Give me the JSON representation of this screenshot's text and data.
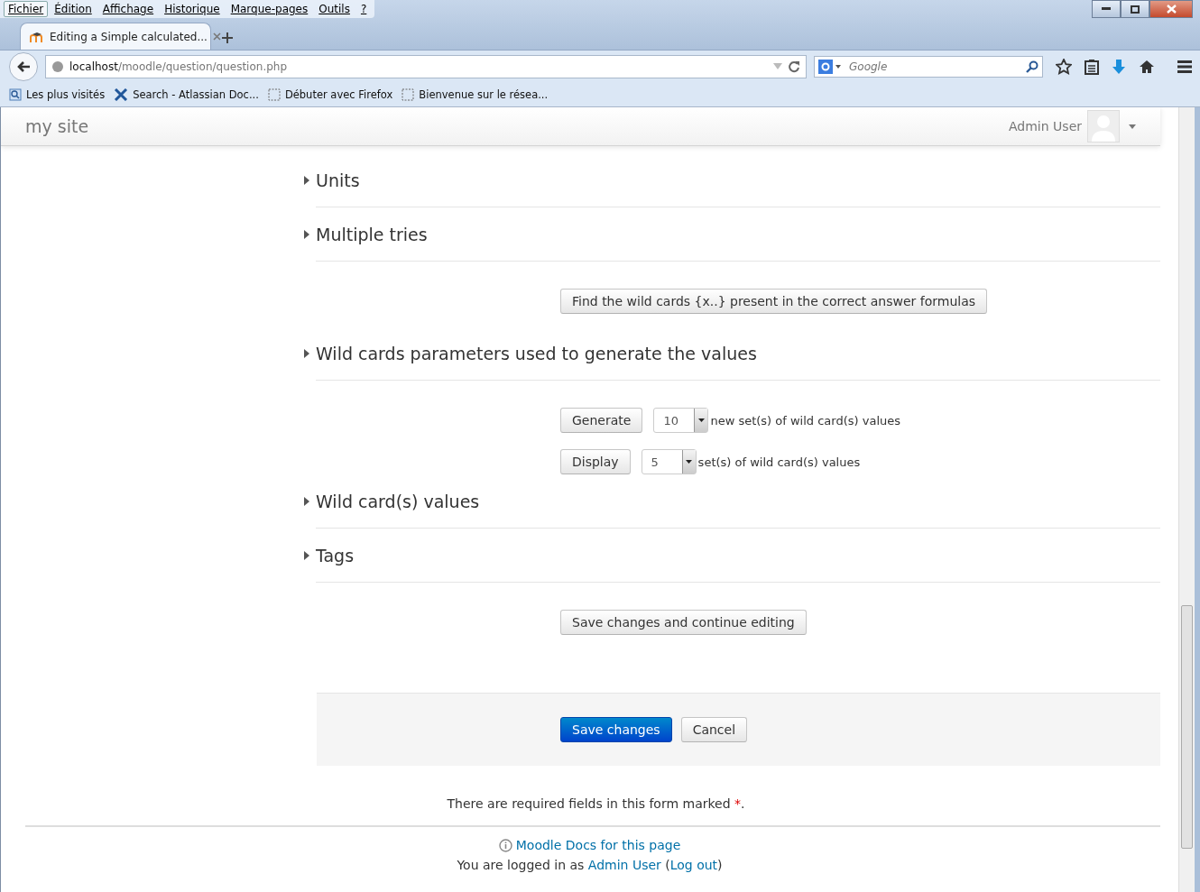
{
  "menu_bar": [
    {
      "label": "Fichier",
      "selected": true
    },
    {
      "label": "Édition",
      "selected": false
    },
    {
      "label": "Affichage",
      "selected": false
    },
    {
      "label": "Historique",
      "selected": false
    },
    {
      "label": "Marque-pages",
      "selected": false
    },
    {
      "label": "Outils",
      "selected": false
    },
    {
      "label": "?",
      "selected": false
    }
  ],
  "tabs": [
    {
      "title": "Editing a Simple calculated...",
      "selected": true
    }
  ],
  "address_bar": {
    "host": "localhost",
    "path": "/moodle/question/question.php"
  },
  "search": {
    "placeholder": "Google"
  },
  "bookmarks": [
    {
      "label": "Les plus visités",
      "kind": "folder"
    },
    {
      "label": "Search - Atlassian Doc...",
      "kind": "site"
    },
    {
      "label": "Débuter avec Firefox",
      "kind": "blank"
    },
    {
      "label": "Bienvenue sur le résea...",
      "kind": "blank"
    }
  ],
  "navbar": {
    "brand": "my site",
    "user": "Admin User"
  },
  "form_items": [
    {
      "kind": "section",
      "title": "Units",
      "expanded": false
    },
    {
      "kind": "section",
      "title": "Multiple tries",
      "expanded": false
    },
    {
      "kind": "button",
      "label": "Find the wild cards {x..} present in the correct answer formulas"
    },
    {
      "kind": "section",
      "title": "Wild cards parameters used to generate the values",
      "expanded": false
    },
    {
      "kind": "select_row",
      "button": "Generate",
      "value": "10",
      "text": "new set(s) of wild card(s) values"
    },
    {
      "kind": "select_row",
      "button": "Display",
      "value": "5",
      "text": "set(s) of wild card(s) values"
    },
    {
      "kind": "section",
      "title": "Wild card(s) values",
      "expanded": false
    },
    {
      "kind": "section",
      "title": "Tags",
      "expanded": false
    },
    {
      "kind": "button",
      "label": "Save changes and continue editing"
    }
  ],
  "actions": [
    {
      "label": "Save changes",
      "primary": true
    },
    {
      "label": "Cancel",
      "primary": false
    }
  ],
  "required_note": {
    "text": "There are required fields in this form marked",
    "mark": "*",
    "end": "."
  },
  "footer": {
    "docs_link": "Moodle Docs for this page",
    "login": {
      "prefix": "You are logged in as",
      "user_link": "Admin User",
      "open": "(",
      "logout_link": "Log out",
      "close": ")"
    }
  }
}
